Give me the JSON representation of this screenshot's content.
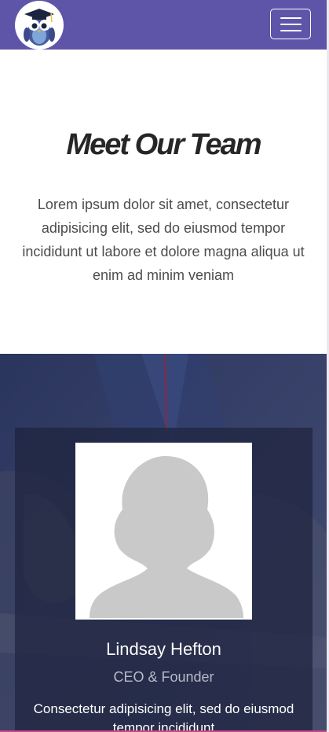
{
  "nav": {
    "logo_icon": "owl-graduate-logo-icon",
    "menu_icon": "hamburger-menu-icon",
    "brand_color": "#5f55a8"
  },
  "intro": {
    "title": "Meet Our Team",
    "description": "Lorem ipsum dolor sit amet, consectetur adipisicing elit, sed do eiusmod tempor incididunt ut labore et dolore magna aliqua ut enim ad minim veniam"
  },
  "team": {
    "members": [
      {
        "name": "Lindsay Hefton",
        "role": "CEO & Founder",
        "bio": "Consectetur adipisicing elit, sed do eiusmod tempor incididunt",
        "photo_icon": "avatar-silhouette-icon"
      }
    ]
  }
}
